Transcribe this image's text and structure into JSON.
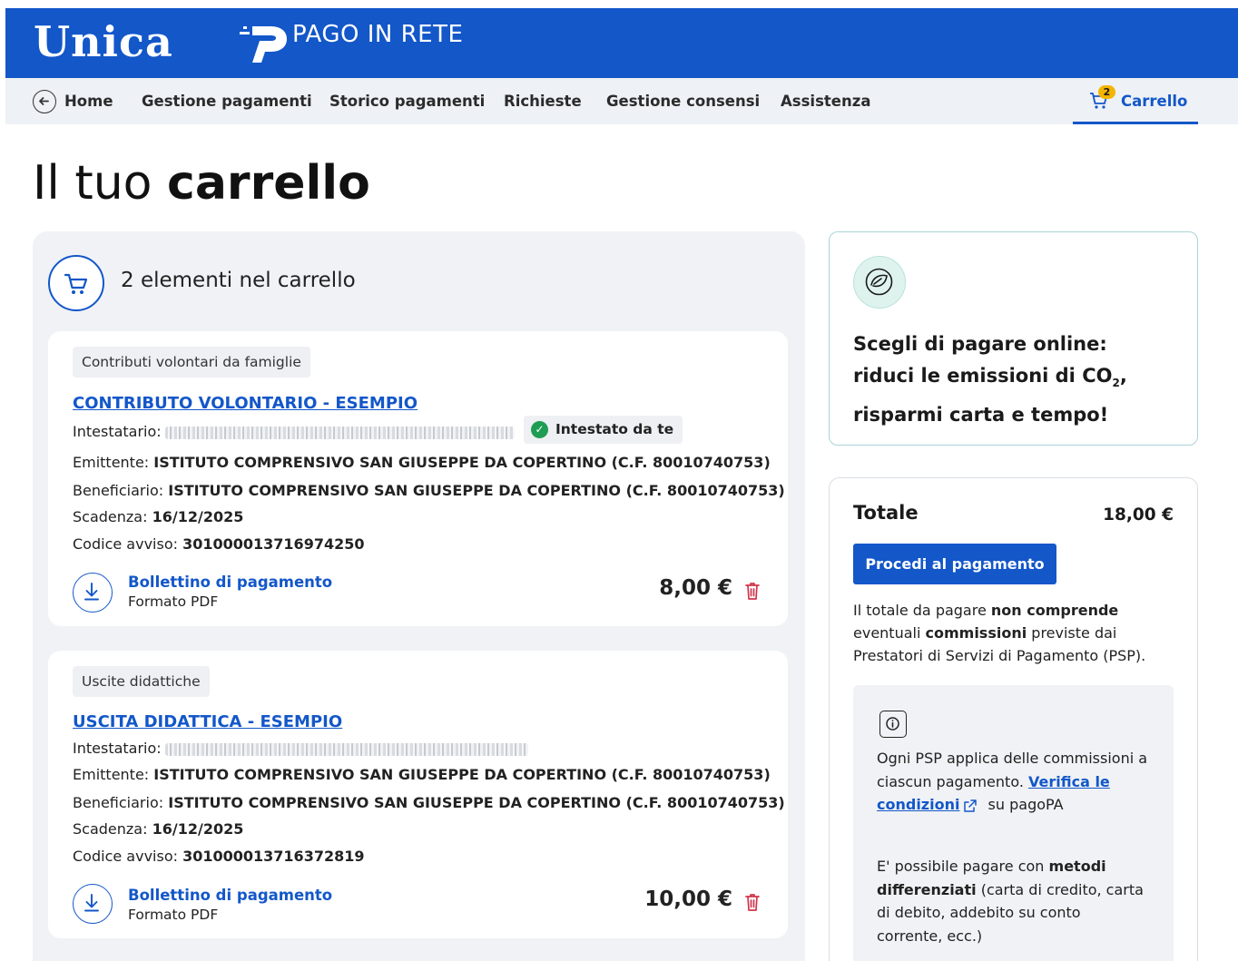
{
  "header": {
    "logo_text": "Unica",
    "app_title": "PAGO IN RETE"
  },
  "nav": {
    "home": "Home",
    "items": [
      "Gestione pagamenti",
      "Storico pagamenti",
      "Richieste",
      "Gestione consensi",
      "Assistenza"
    ],
    "cart_label": "Carrello",
    "cart_badge": "2"
  },
  "page": {
    "title_light": "Il tuo",
    "title_bold": "carrello"
  },
  "cart": {
    "count_text": "2 elementi nel carrello",
    "items": [
      {
        "category": "Contributi volontari da famiglie",
        "title": "CONTRIBUTO VOLONTARIO - ESEMPIO",
        "holder_label": "Intestatario:",
        "owner_badge": "Intestato da te",
        "issuer_label": "Emittente:",
        "issuer": "ISTITUTO COMPRENSIVO SAN GIUSEPPE DA COPERTINO (C.F. 80010740753)",
        "beneficiary_label": "Beneficiario:",
        "beneficiary": "ISTITUTO COMPRENSIVO SAN GIUSEPPE DA COPERTINO (C.F. 80010740753)",
        "due_label": "Scadenza:",
        "due": "16/12/2025",
        "code_label": "Codice avviso:",
        "code": "301000013716974250",
        "download_label": "Bollettino di pagamento",
        "download_format": "Formato PDF",
        "amount": "8,00 €"
      },
      {
        "category": "Uscite didattiche",
        "title": "USCITA DIDATTICA - ESEMPIO",
        "holder_label": "Intestatario:",
        "issuer_label": "Emittente:",
        "issuer": "ISTITUTO COMPRENSIVO SAN GIUSEPPE DA COPERTINO (C.F. 80010740753)",
        "beneficiary_label": "Beneficiario:",
        "beneficiary": "ISTITUTO COMPRENSIVO SAN GIUSEPPE DA COPERTINO (C.F. 80010740753)",
        "due_label": "Scadenza:",
        "due": "16/12/2025",
        "code_label": "Codice avviso:",
        "code": "301000013716372819",
        "download_label": "Bollettino di pagamento",
        "download_format": "Formato PDF",
        "amount": "10,00 €"
      }
    ]
  },
  "promo": {
    "line1": "Scegli di pagare online:",
    "line2_pre": "riduci le emissioni di CO",
    "line2_sub": "2",
    "line2_post": ",",
    "line3": "risparmi carta e tempo!"
  },
  "summary": {
    "total_label": "Totale",
    "total_value": "18,00 €",
    "pay_button": "Procedi al pagamento",
    "note_1": "Il totale da pagare ",
    "note_b1": "non comprende",
    "note_2": " eventuali ",
    "note_b2": "commissioni",
    "note_3": " previste dai Prestatori di Servizi di Pagamento (PSP).",
    "info_1": "Ogni PSP applica delle commissioni a ciascun pagamento. ",
    "info_link": "Verifica le condizioni",
    "info_2": " su pagoPA",
    "info_3": "E' possibile pagare con ",
    "info_b": "metodi differenziati",
    "info_4": " (carta di credito, carta di debito, addebito su conto corrente, ecc.)"
  },
  "colors": {
    "brand_blue": "#1357c9",
    "badge_yellow": "#f4b400",
    "success_green": "#1f9d55",
    "delete_red": "#d1344a"
  }
}
